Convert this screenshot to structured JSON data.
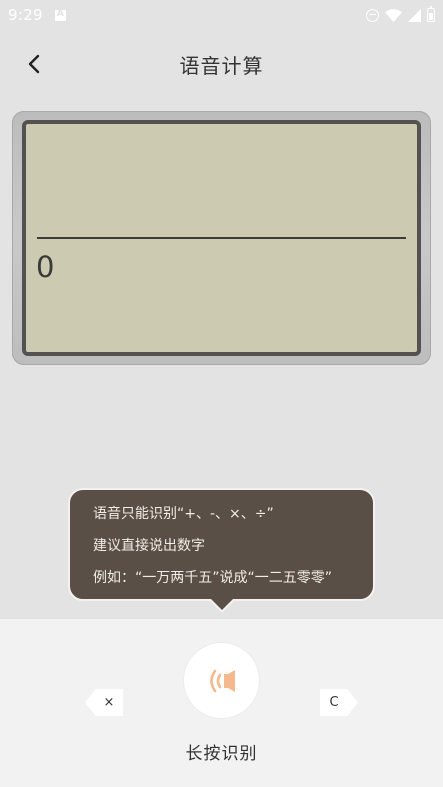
{
  "status_bar": {
    "time": "9:29",
    "icons": [
      "a-icon",
      "do-not-disturb-icon",
      "wifi-icon",
      "signal-icon",
      "battery-icon"
    ]
  },
  "header": {
    "back_icon": "chevron-left-icon",
    "title": "语音计算"
  },
  "display": {
    "expression": "",
    "value": "0"
  },
  "tooltip": {
    "lines": [
      "语音只能识别“+、-、×、÷”",
      "建议直接说出数字",
      "例如：“一万两千五”说成“一二五零零”"
    ]
  },
  "controls": {
    "delete_label": "×",
    "clear_label": "C",
    "mic_icon": "voice-wave-icon",
    "hint": "长按识别"
  },
  "colors": {
    "background": "#e3e3e3",
    "lcd": "#cccab0",
    "lcd_border": "#545250",
    "tooltip": "#5a4f46",
    "mic_accent": "#f6b98e"
  }
}
